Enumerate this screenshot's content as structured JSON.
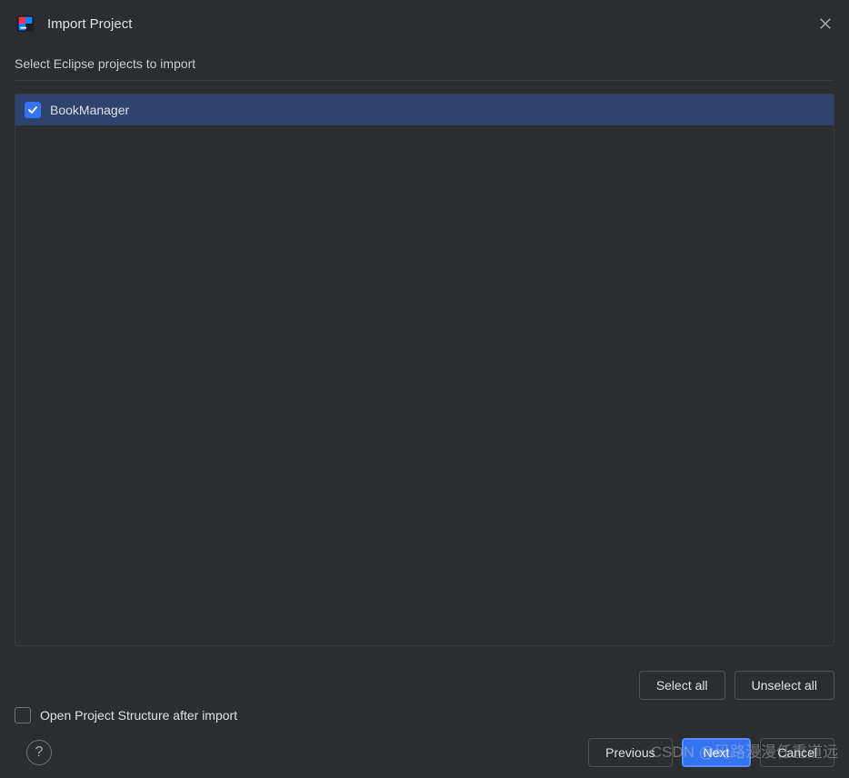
{
  "dialog": {
    "title": "Import Project",
    "instruction": "Select Eclipse projects to import"
  },
  "projects": [
    {
      "name": "BookManager",
      "checked": true
    }
  ],
  "selection_buttons": {
    "select_all": "Select all",
    "unselect_all": "Unselect all"
  },
  "open_structure": {
    "label": "Open Project Structure after import",
    "checked": false
  },
  "footer_buttons": {
    "previous": "Previous",
    "next": "Next",
    "cancel": "Cancel"
  },
  "help": {
    "symbol": "?"
  },
  "watermark": "CSDN @码路漫漫任重道远"
}
